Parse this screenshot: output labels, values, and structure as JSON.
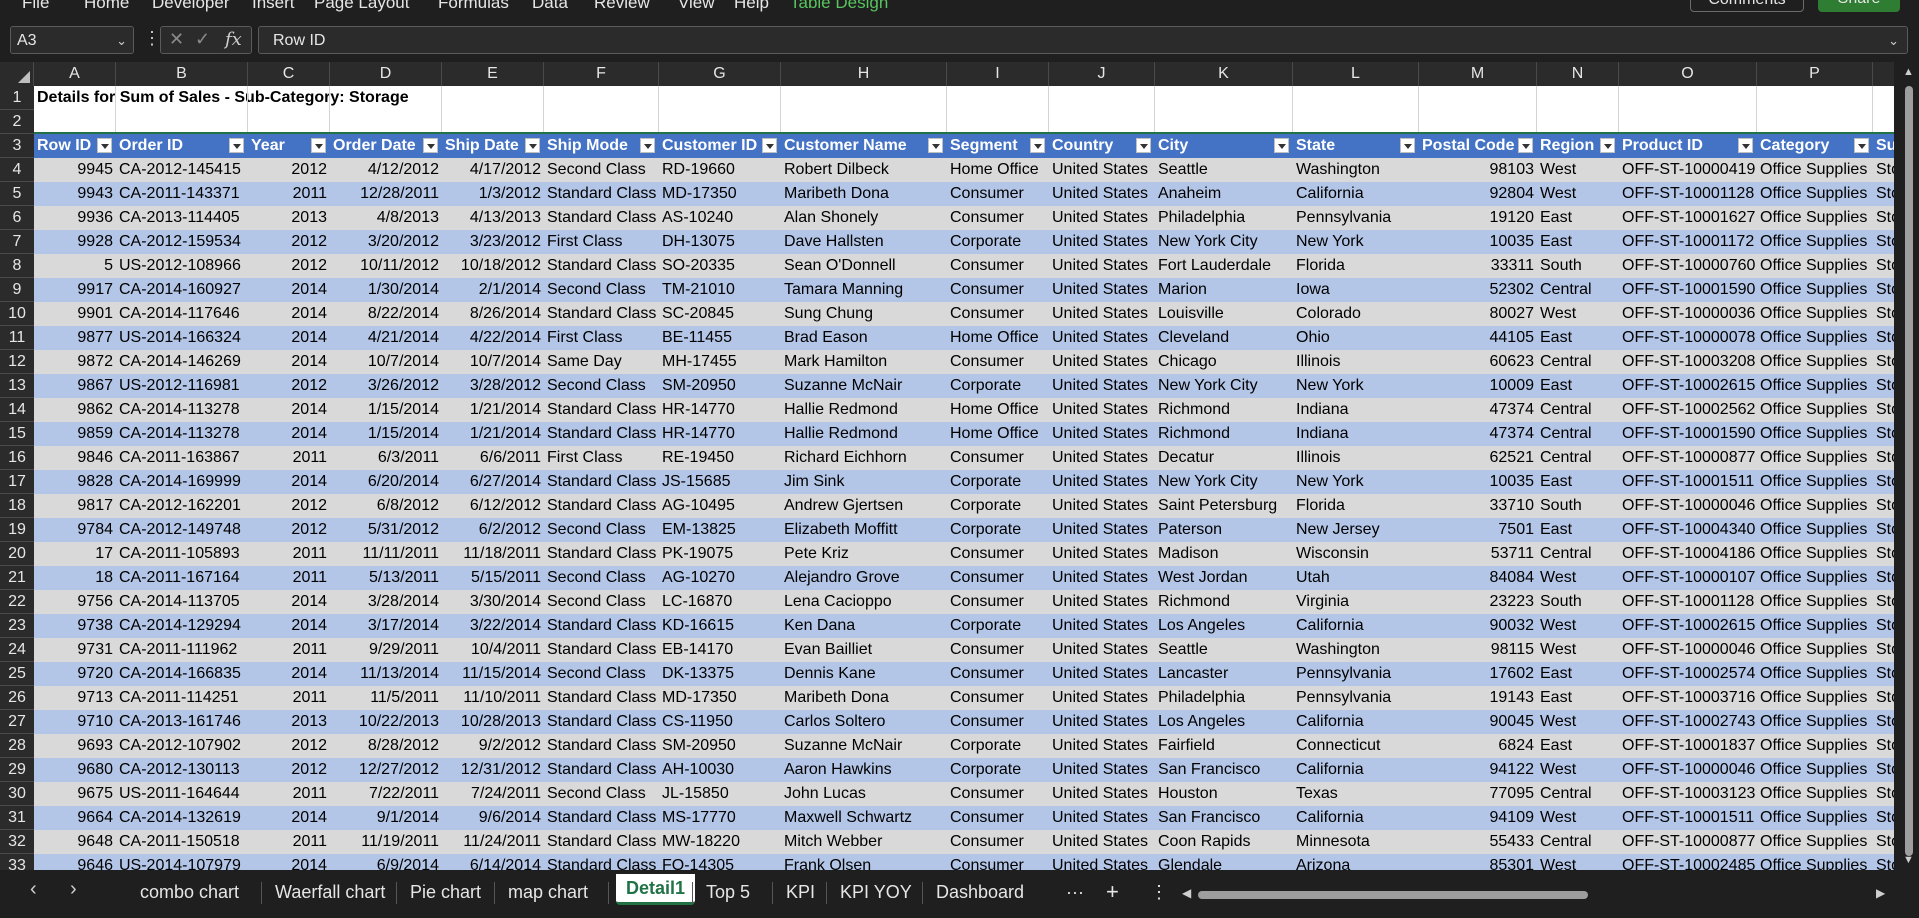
{
  "ribbon": {
    "tabs": [
      "File",
      "Home",
      "Developer",
      "Insert",
      "Page Layout",
      "Formulas",
      "Data",
      "Review",
      "View",
      "Help",
      "Table Design"
    ],
    "comments_label": "Comments",
    "share_label": "Share"
  },
  "formula_bar": {
    "name_box": "A3",
    "cancel_icon": "✕",
    "enter_icon": "✓",
    "fx_icon": "fx",
    "content": "Row ID"
  },
  "columns": [
    "A",
    "B",
    "C",
    "D",
    "E",
    "F",
    "G",
    "H",
    "I",
    "J",
    "K",
    "L",
    "M",
    "N",
    "O",
    "P"
  ],
  "row_numbers": [
    "1",
    "2",
    "3",
    "4",
    "5",
    "6",
    "7",
    "8",
    "9",
    "10",
    "11",
    "12",
    "13",
    "14",
    "15",
    "16",
    "17",
    "18",
    "19",
    "20",
    "21",
    "22",
    "23",
    "24",
    "25",
    "26",
    "27",
    "28",
    "29",
    "30",
    "31",
    "32",
    "33"
  ],
  "sheet_title": "Details for Sum of Sales - Sub-Category: Storage",
  "table": {
    "headers": [
      "Row ID",
      "Order ID",
      "Year",
      "Order Date",
      "Ship Date",
      "Ship Mode",
      "Customer ID",
      "Customer Name",
      "Segment",
      "Country",
      "City",
      "State",
      "Postal Code",
      "Region",
      "Product ID",
      "Category",
      "Su"
    ],
    "rows": [
      [
        "9945",
        "CA-2012-145415",
        "2012",
        "4/12/2012",
        "4/17/2012",
        "Second Class",
        "RD-19660",
        "Robert Dilbeck",
        "Home Office",
        "United States",
        "Seattle",
        "Washington",
        "98103",
        "West",
        "OFF-ST-10000419",
        "Office Supplies",
        "Sto"
      ],
      [
        "9943",
        "CA-2011-143371",
        "2011",
        "12/28/2011",
        "1/3/2012",
        "Standard Class",
        "MD-17350",
        "Maribeth Dona",
        "Consumer",
        "United States",
        "Anaheim",
        "California",
        "92804",
        "West",
        "OFF-ST-10001128",
        "Office Supplies",
        "Sto"
      ],
      [
        "9936",
        "CA-2013-114405",
        "2013",
        "4/8/2013",
        "4/13/2013",
        "Standard Class",
        "AS-10240",
        "Alan Shonely",
        "Consumer",
        "United States",
        "Philadelphia",
        "Pennsylvania",
        "19120",
        "East",
        "OFF-ST-10001627",
        "Office Supplies",
        "Sto"
      ],
      [
        "9928",
        "CA-2012-159534",
        "2012",
        "3/20/2012",
        "3/23/2012",
        "First Class",
        "DH-13075",
        "Dave Hallsten",
        "Corporate",
        "United States",
        "New York City",
        "New York",
        "10035",
        "East",
        "OFF-ST-10001172",
        "Office Supplies",
        "Sto"
      ],
      [
        "5",
        "US-2012-108966",
        "2012",
        "10/11/2012",
        "10/18/2012",
        "Standard Class",
        "SO-20335",
        "Sean O'Donnell",
        "Consumer",
        "United States",
        "Fort Lauderdale",
        "Florida",
        "33311",
        "South",
        "OFF-ST-10000760",
        "Office Supplies",
        "Sto"
      ],
      [
        "9917",
        "CA-2014-160927",
        "2014",
        "1/30/2014",
        "2/1/2014",
        "Second Class",
        "TM-21010",
        "Tamara Manning",
        "Consumer",
        "United States",
        "Marion",
        "Iowa",
        "52302",
        "Central",
        "OFF-ST-10001590",
        "Office Supplies",
        "Sto"
      ],
      [
        "9901",
        "CA-2014-117646",
        "2014",
        "8/22/2014",
        "8/26/2014",
        "Standard Class",
        "SC-20845",
        "Sung Chung",
        "Consumer",
        "United States",
        "Louisville",
        "Colorado",
        "80027",
        "West",
        "OFF-ST-10000036",
        "Office Supplies",
        "Sto"
      ],
      [
        "9877",
        "US-2014-166324",
        "2014",
        "4/21/2014",
        "4/22/2014",
        "First Class",
        "BE-11455",
        "Brad Eason",
        "Home Office",
        "United States",
        "Cleveland",
        "Ohio",
        "44105",
        "East",
        "OFF-ST-10000078",
        "Office Supplies",
        "Sto"
      ],
      [
        "9872",
        "CA-2014-146269",
        "2014",
        "10/7/2014",
        "10/7/2014",
        "Same Day",
        "MH-17455",
        "Mark Hamilton",
        "Consumer",
        "United States",
        "Chicago",
        "Illinois",
        "60623",
        "Central",
        "OFF-ST-10003208",
        "Office Supplies",
        "Sto"
      ],
      [
        "9867",
        "US-2012-116981",
        "2012",
        "3/26/2012",
        "3/28/2012",
        "Second Class",
        "SM-20950",
        "Suzanne McNair",
        "Corporate",
        "United States",
        "New York City",
        "New York",
        "10009",
        "East",
        "OFF-ST-10002615",
        "Office Supplies",
        "Sto"
      ],
      [
        "9862",
        "CA-2014-113278",
        "2014",
        "1/15/2014",
        "1/21/2014",
        "Standard Class",
        "HR-14770",
        "Hallie Redmond",
        "Home Office",
        "United States",
        "Richmond",
        "Indiana",
        "47374",
        "Central",
        "OFF-ST-10002562",
        "Office Supplies",
        "Sto"
      ],
      [
        "9859",
        "CA-2014-113278",
        "2014",
        "1/15/2014",
        "1/21/2014",
        "Standard Class",
        "HR-14770",
        "Hallie Redmond",
        "Home Office",
        "United States",
        "Richmond",
        "Indiana",
        "47374",
        "Central",
        "OFF-ST-10001590",
        "Office Supplies",
        "Sto"
      ],
      [
        "9846",
        "CA-2011-163867",
        "2011",
        "6/3/2011",
        "6/6/2011",
        "First Class",
        "RE-19450",
        "Richard Eichhorn",
        "Consumer",
        "United States",
        "Decatur",
        "Illinois",
        "62521",
        "Central",
        "OFF-ST-10000877",
        "Office Supplies",
        "Sto"
      ],
      [
        "9828",
        "CA-2014-169999",
        "2014",
        "6/20/2014",
        "6/27/2014",
        "Standard Class",
        "JS-15685",
        "Jim Sink",
        "Corporate",
        "United States",
        "New York City",
        "New York",
        "10035",
        "East",
        "OFF-ST-10001511",
        "Office Supplies",
        "Sto"
      ],
      [
        "9817",
        "CA-2012-162201",
        "2012",
        "6/8/2012",
        "6/12/2012",
        "Standard Class",
        "AG-10495",
        "Andrew Gjertsen",
        "Corporate",
        "United States",
        "Saint Petersburg",
        "Florida",
        "33710",
        "South",
        "OFF-ST-10000046",
        "Office Supplies",
        "Sto"
      ],
      [
        "9784",
        "CA-2012-149748",
        "2012",
        "5/31/2012",
        "6/2/2012",
        "Second Class",
        "EM-13825",
        "Elizabeth Moffitt",
        "Corporate",
        "United States",
        "Paterson",
        "New Jersey",
        "7501",
        "East",
        "OFF-ST-10004340",
        "Office Supplies",
        "Sto"
      ],
      [
        "17",
        "CA-2011-105893",
        "2011",
        "11/11/2011",
        "11/18/2011",
        "Standard Class",
        "PK-19075",
        "Pete Kriz",
        "Consumer",
        "United States",
        "Madison",
        "Wisconsin",
        "53711",
        "Central",
        "OFF-ST-10004186",
        "Office Supplies",
        "Sto"
      ],
      [
        "18",
        "CA-2011-167164",
        "2011",
        "5/13/2011",
        "5/15/2011",
        "Second Class",
        "AG-10270",
        "Alejandro Grove",
        "Consumer",
        "United States",
        "West Jordan",
        "Utah",
        "84084",
        "West",
        "OFF-ST-10000107",
        "Office Supplies",
        "Sto"
      ],
      [
        "9756",
        "CA-2014-113705",
        "2014",
        "3/28/2014",
        "3/30/2014",
        "Second Class",
        "LC-16870",
        "Lena Cacioppo",
        "Consumer",
        "United States",
        "Richmond",
        "Virginia",
        "23223",
        "South",
        "OFF-ST-10001128",
        "Office Supplies",
        "Sto"
      ],
      [
        "9738",
        "CA-2014-129294",
        "2014",
        "3/17/2014",
        "3/22/2014",
        "Standard Class",
        "KD-16615",
        "Ken Dana",
        "Corporate",
        "United States",
        "Los Angeles",
        "California",
        "90032",
        "West",
        "OFF-ST-10002615",
        "Office Supplies",
        "Sto"
      ],
      [
        "9731",
        "CA-2011-111962",
        "2011",
        "9/29/2011",
        "10/4/2011",
        "Standard Class",
        "EB-14170",
        "Evan Bailliet",
        "Consumer",
        "United States",
        "Seattle",
        "Washington",
        "98115",
        "West",
        "OFF-ST-10000046",
        "Office Supplies",
        "Sto"
      ],
      [
        "9720",
        "CA-2014-166835",
        "2014",
        "11/13/2014",
        "11/15/2014",
        "Second Class",
        "DK-13375",
        "Dennis Kane",
        "Consumer",
        "United States",
        "Lancaster",
        "Pennsylvania",
        "17602",
        "East",
        "OFF-ST-10002574",
        "Office Supplies",
        "Sto"
      ],
      [
        "9713",
        "CA-2011-114251",
        "2011",
        "11/5/2011",
        "11/10/2011",
        "Standard Class",
        "MD-17350",
        "Maribeth Dona",
        "Consumer",
        "United States",
        "Philadelphia",
        "Pennsylvania",
        "19143",
        "East",
        "OFF-ST-10003716",
        "Office Supplies",
        "Sto"
      ],
      [
        "9710",
        "CA-2013-161746",
        "2013",
        "10/22/2013",
        "10/28/2013",
        "Standard Class",
        "CS-11950",
        "Carlos Soltero",
        "Consumer",
        "United States",
        "Los Angeles",
        "California",
        "90045",
        "West",
        "OFF-ST-10002743",
        "Office Supplies",
        "Sto"
      ],
      [
        "9693",
        "CA-2012-107902",
        "2012",
        "8/28/2012",
        "9/2/2012",
        "Standard Class",
        "SM-20950",
        "Suzanne McNair",
        "Corporate",
        "United States",
        "Fairfield",
        "Connecticut",
        "6824",
        "East",
        "OFF-ST-10001837",
        "Office Supplies",
        "Sto"
      ],
      [
        "9680",
        "CA-2012-130113",
        "2012",
        "12/27/2012",
        "12/31/2012",
        "Standard Class",
        "AH-10030",
        "Aaron Hawkins",
        "Corporate",
        "United States",
        "San Francisco",
        "California",
        "94122",
        "West",
        "OFF-ST-10000046",
        "Office Supplies",
        "Sto"
      ],
      [
        "9675",
        "US-2011-164644",
        "2011",
        "7/22/2011",
        "7/24/2011",
        "Second Class",
        "JL-15850",
        "John Lucas",
        "Consumer",
        "United States",
        "Houston",
        "Texas",
        "77095",
        "Central",
        "OFF-ST-10003123",
        "Office Supplies",
        "Sto"
      ],
      [
        "9664",
        "CA-2014-132619",
        "2014",
        "9/1/2014",
        "9/6/2014",
        "Standard Class",
        "MS-17770",
        "Maxwell Schwartz",
        "Consumer",
        "United States",
        "San Francisco",
        "California",
        "94109",
        "West",
        "OFF-ST-10001511",
        "Office Supplies",
        "Sto"
      ],
      [
        "9648",
        "CA-2011-150518",
        "2011",
        "11/19/2011",
        "11/24/2011",
        "Standard Class",
        "MW-18220",
        "Mitch Webber",
        "Consumer",
        "United States",
        "Coon Rapids",
        "Minnesota",
        "55433",
        "Central",
        "OFF-ST-10000877",
        "Office Supplies",
        "Sto"
      ],
      [
        "9646",
        "US-2014-107979",
        "2014",
        "6/9/2014",
        "6/14/2014",
        "Standard Class",
        "FO-14305",
        "Frank Olsen",
        "Consumer",
        "United States",
        "Glendale",
        "Arizona",
        "85301",
        "West",
        "OFF-ST-10002485",
        "Office Supplies",
        "Sto"
      ]
    ]
  },
  "sheet_tabs": {
    "prev_icon": "‹",
    "next_icon": "›",
    "tabs": [
      "combo chart",
      "Waerfall chart",
      "Pie chart",
      "map chart",
      "Detail1",
      "Top 5",
      "KPI",
      "KPI YOY",
      "Dashboard"
    ],
    "active_tab": "Detail1",
    "more_label": "···",
    "add_label": "+",
    "options_label": "⋮"
  }
}
